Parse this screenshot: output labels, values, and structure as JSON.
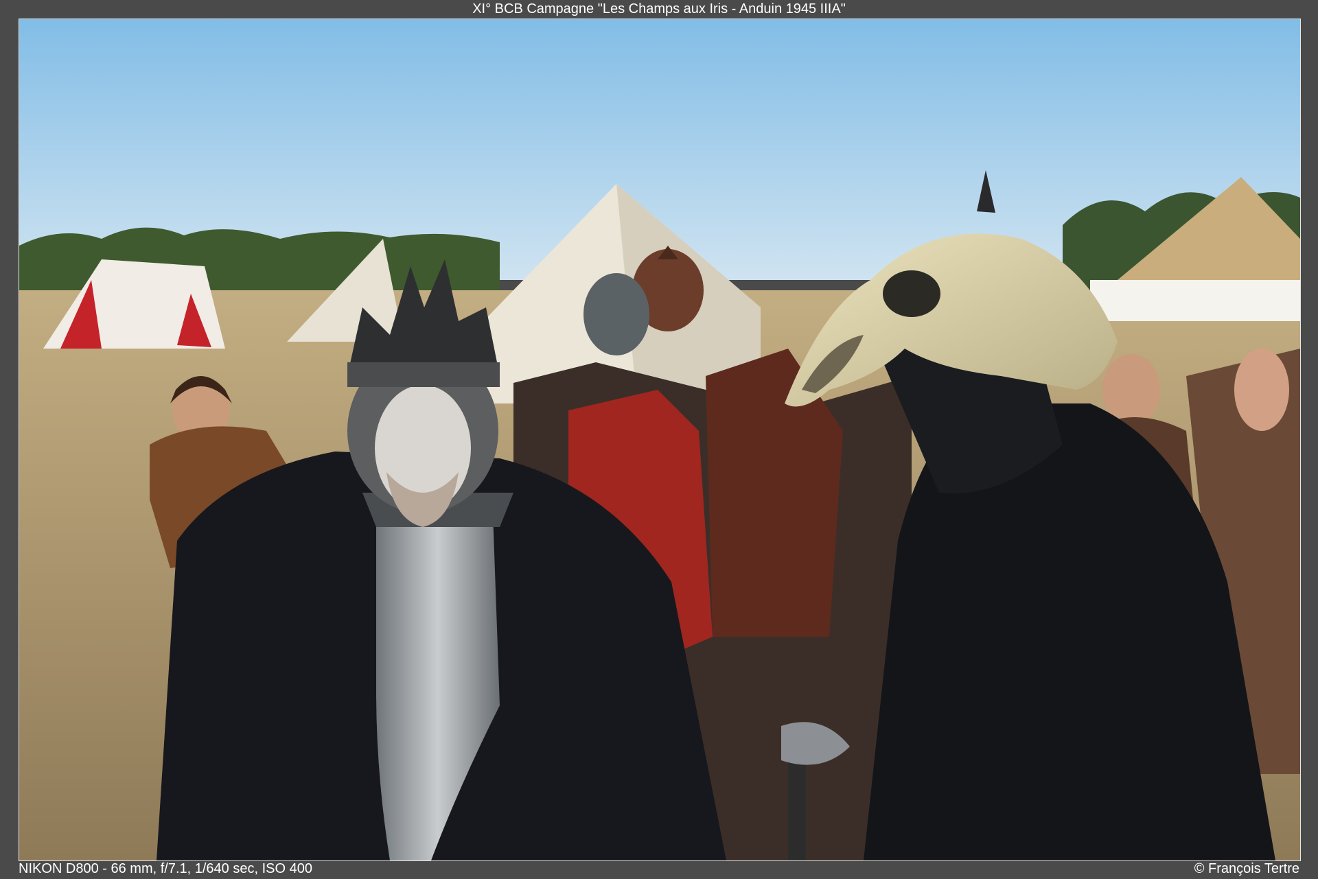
{
  "title": "XI° BCB Campagne \"Les Champs aux Iris - Anduin 1945 IIIA\"",
  "exif": "NIKON D800 - 66 mm, f/7.1, 1/640 sec, ISO 400",
  "credit": "© François Tertre",
  "colors": {
    "frame": "#4a4a4a",
    "sky_top": "#8ec2e6",
    "sky_bottom": "#c9dff0",
    "field": "#b29a6e",
    "cloak": "#17181d",
    "skull_mask": "#d8d0a7"
  }
}
